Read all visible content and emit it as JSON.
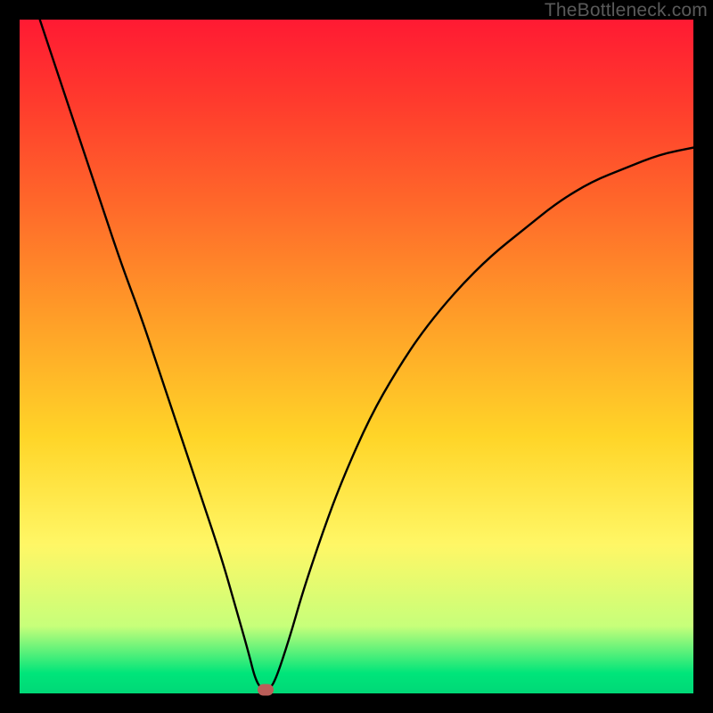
{
  "watermark": "TheBottleneck.com",
  "chart_data": {
    "type": "line",
    "title": "",
    "xlabel": "",
    "ylabel": "",
    "xlim": [
      0,
      100
    ],
    "ylim": [
      0,
      100
    ],
    "series": [
      {
        "name": "curve",
        "x": [
          3,
          6,
          9,
          12,
          15,
          18,
          21,
          24,
          27,
          30,
          32,
          34,
          35,
          36,
          37,
          38,
          40,
          42,
          45,
          48,
          52,
          56,
          60,
          65,
          70,
          75,
          80,
          85,
          90,
          95,
          100
        ],
        "values": [
          100,
          91,
          82,
          73,
          64,
          56,
          47,
          38,
          29,
          20,
          13,
          6,
          2,
          0.5,
          0.5,
          2,
          8,
          15,
          24,
          32,
          41,
          48,
          54,
          60,
          65,
          69,
          73,
          76,
          78,
          80,
          81
        ]
      }
    ],
    "marker": {
      "x": 36.5,
      "y": 0.5
    },
    "gradient_stops": [
      {
        "pos": 0,
        "color": "#ff1a33"
      },
      {
        "pos": 28,
        "color": "#ff6a2a"
      },
      {
        "pos": 62,
        "color": "#ffd528"
      },
      {
        "pos": 90,
        "color": "#c7ff7a"
      },
      {
        "pos": 100,
        "color": "#00d877"
      }
    ]
  }
}
